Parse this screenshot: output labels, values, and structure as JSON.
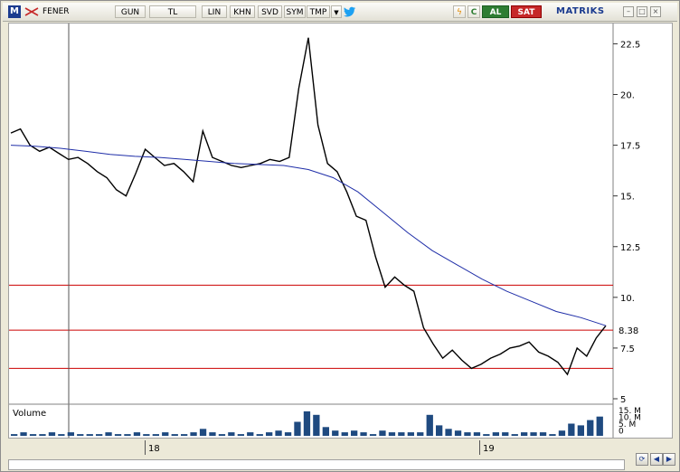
{
  "toolbar": {
    "logo": "M",
    "symbol": "FENER",
    "buttons": [
      "GUN",
      "TL",
      "LIN",
      "KHN",
      "SVD",
      "SYM",
      "TMP"
    ],
    "dropdown_icon": "caret-down-icon",
    "twitter_icon": "twitter-bird-icon",
    "lightning_icon": "lightning-icon",
    "refresh_label": "C",
    "buy_label": "AL",
    "sell_label": "SAT",
    "brand": "MATRIKS",
    "window_buttons": [
      "minimize-icon",
      "maximize-icon",
      "close-icon"
    ]
  },
  "chart_data": {
    "type": "line",
    "series": [
      {
        "values": [
          18.1,
          18.3,
          17.5,
          17.2,
          17.4,
          17.1,
          16.8,
          16.9,
          16.6,
          16.2,
          15.9,
          15.3,
          15.0,
          16.1,
          17.3,
          16.9,
          16.5,
          16.6,
          16.2,
          15.7,
          18.2,
          16.9,
          16.7,
          16.5,
          16.4,
          16.5,
          16.6,
          16.8,
          16.7,
          16.9,
          20.3,
          22.8,
          18.5,
          16.6,
          16.2,
          15.2,
          14.0,
          13.8,
          12.0,
          10.5,
          11.0,
          10.6,
          10.3,
          8.5,
          7.7,
          7.0,
          7.4,
          6.9,
          6.5,
          6.7,
          7.0,
          7.2,
          7.5,
          7.6,
          7.8,
          7.3,
          7.1,
          6.8,
          6.2,
          7.5,
          7.1,
          8.0,
          8.6
        ],
        "color": "#000000"
      },
      {
        "values": [
          17.5,
          17.45,
          17.35,
          17.2,
          17.05,
          16.95,
          16.9,
          16.8,
          16.7,
          16.6,
          16.55,
          16.5,
          16.3,
          15.9,
          15.2,
          14.2,
          13.2,
          12.3,
          11.6,
          10.9,
          10.3,
          9.8,
          9.3,
          9.0,
          8.6
        ],
        "color": "#1f2ea8"
      }
    ],
    "x_ticks": [
      "18",
      "19"
    ],
    "y_ticks": [
      "22.5",
      "20.",
      "17.5",
      "15.",
      "12.5",
      "10.",
      "7.5",
      "5"
    ],
    "last_value_label": "8.38",
    "ylim": [
      5,
      23.5
    ],
    "horizontal_lines": [
      10.6,
      8.38,
      6.5
    ],
    "volume": {
      "label": "Volume",
      "y_ticks": [
        "15. M",
        "10. M",
        "5. M",
        "0"
      ],
      "values": [
        1,
        2,
        1,
        1,
        2,
        1,
        2,
        1,
        1,
        1,
        2,
        1,
        1,
        2,
        1,
        1,
        2,
        1,
        1,
        2,
        4,
        2,
        1,
        2,
        1,
        2,
        1,
        2,
        3,
        2,
        8,
        14,
        12,
        5,
        3,
        2,
        3,
        2,
        1,
        3,
        2,
        2,
        2,
        2,
        12,
        6,
        4,
        3,
        2,
        2,
        1,
        2,
        2,
        1,
        2,
        2,
        2,
        1,
        3,
        7,
        6,
        9,
        11
      ]
    }
  },
  "nav": {
    "refresh_icon": "sync-icon",
    "left_icon": "arrow-left-icon",
    "right_icon": "arrow-right-icon"
  }
}
